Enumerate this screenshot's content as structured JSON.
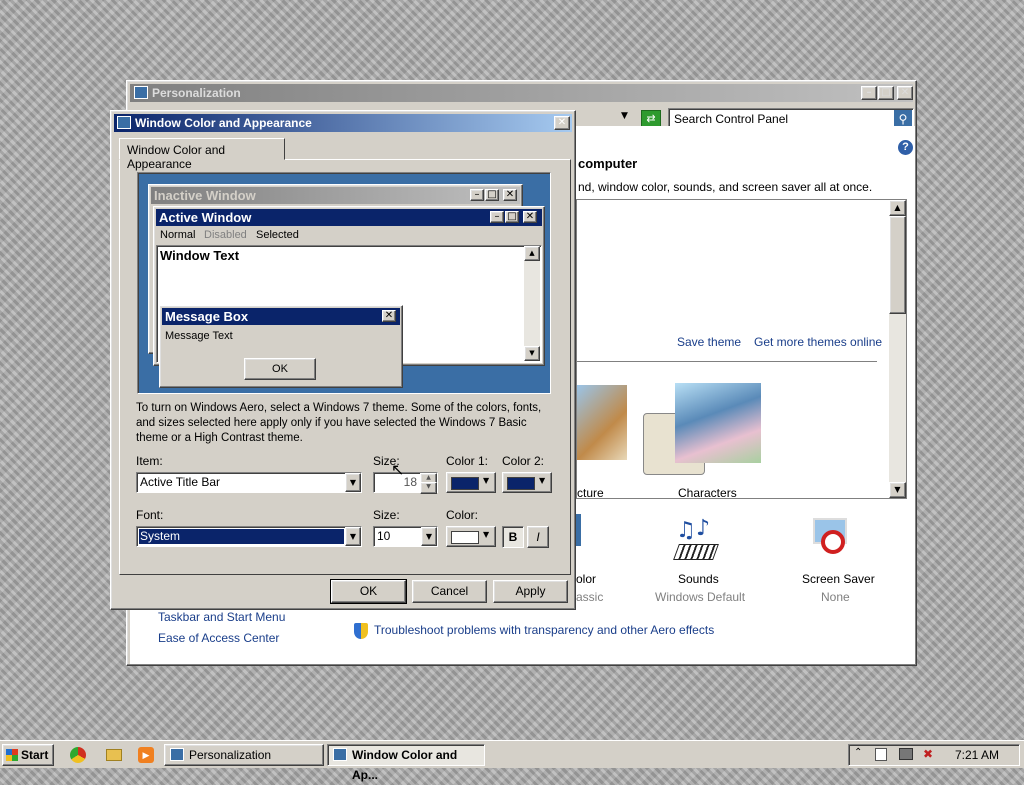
{
  "personalization": {
    "title": "Personalization",
    "search_placeholder": "Search Control Panel",
    "heading": "computer",
    "description": "nd, window color, sounds, and screen saver all at once.",
    "save_theme": "Save theme",
    "get_more_themes": "Get more themes online",
    "theme_label": "Characters",
    "partial_theme_label": "cture",
    "sounds_label": "Sounds",
    "sounds_value": "Windows Default",
    "screensaver_label": "Screen Saver",
    "screensaver_value": "None",
    "color_partial": "olor",
    "color_value_partial": "assic",
    "left_link_1": "Taskbar and Start Menu",
    "left_link_2": "Ease of Access Center",
    "troubleshoot": "Troubleshoot problems with transparency and other Aero effects"
  },
  "dialog": {
    "title": "Window Color and Appearance",
    "tab": "Window Color and Appearance",
    "preview": {
      "inactive_title": "Inactive Window",
      "active_title": "Active Window",
      "menu_normal": "Normal",
      "menu_disabled": "Disabled",
      "menu_selected": "Selected",
      "window_text": "Window Text",
      "msgbox_title": "Message Box",
      "msgbox_text": "Message Text",
      "msgbox_ok": "OK"
    },
    "info_text": "To turn on Windows Aero, select a Windows 7 theme.  Some of the colors, fonts, and sizes selected here apply only if you have selected the Windows 7 Basic theme or a High Contrast theme.",
    "item_label": "Item:",
    "item_value": "Active Title Bar",
    "item_size_label": "Size:",
    "item_size_value": "18",
    "color1_label": "Color 1:",
    "color2_label": "Color 2:",
    "font_label": "Font:",
    "font_value": "System",
    "font_size_label": "Size:",
    "font_size_value": "10",
    "font_color_label": "Color:",
    "bold_label": "B",
    "italic_label": "I",
    "ok": "OK",
    "cancel": "Cancel",
    "apply": "Apply",
    "colors": {
      "color1": "#0a246a",
      "color2": "#0a246a",
      "font_color": "#ffffff"
    }
  },
  "taskbar": {
    "start": "Start",
    "task1": "Personalization",
    "task2": "Window Color and Ap...",
    "time": "7:21 AM"
  }
}
